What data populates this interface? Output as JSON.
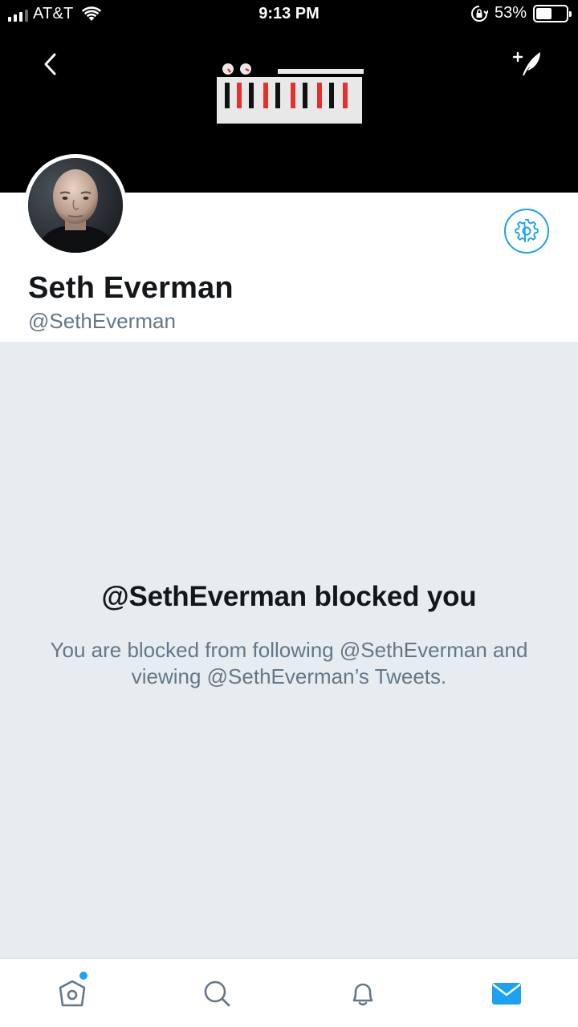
{
  "status_bar": {
    "carrier": "AT&T",
    "time": "9:13 PM",
    "battery_percent": "53%",
    "battery_level": 0.53
  },
  "profile": {
    "display_name": "Seth Everman",
    "handle": "@SethEverman"
  },
  "blocked": {
    "title": "@SethEverman blocked you",
    "description": "You are blocked from following @SethEverman and viewing @SethEverman’s Tweets."
  },
  "tab_bar": {
    "tabs": [
      {
        "icon": "home-icon",
        "active": false,
        "has_notification_dot": true
      },
      {
        "icon": "search-icon",
        "active": false,
        "has_notification_dot": false
      },
      {
        "icon": "bell-icon",
        "active": false,
        "has_notification_dot": false
      },
      {
        "icon": "mail-icon",
        "active": true,
        "has_notification_dot": false
      }
    ]
  },
  "colors": {
    "accent": "#1da1f2",
    "text_primary": "#14171a",
    "text_secondary": "#657786",
    "background_muted": "#e6ecf0",
    "banner": "#000000",
    "keyboard_red": "#e0332f"
  }
}
